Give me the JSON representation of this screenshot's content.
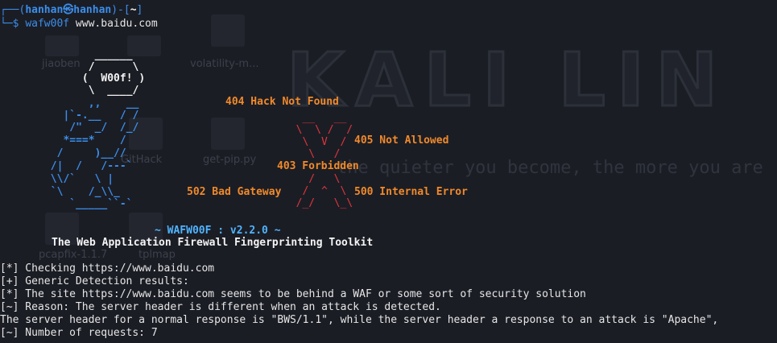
{
  "prompt": {
    "corner": "┌──(",
    "user": "hanhan㉿hanhan",
    "mid": ")-[",
    "dir": "~",
    "end": "]",
    "dollar": "└─$ ",
    "command": "wafw00f",
    "target": " www.baidu.com"
  },
  "background": {
    "motto": "the quieter you become, the more you are",
    "icons": [
      "jiaoben",
      "volatility-m...",
      "get-pip.py",
      "pcapfix-1.1.7",
      "GitHack",
      "tplmap"
    ]
  },
  "banner": {
    "owl": [
      "              ______",
      "             /      \\",
      "            (  W00f! )",
      "             \\  ____/",
      "             ,,    __",
      "         |`-.__   / /",
      "          /\"  _/  /_/",
      "         *===*    /",
      "        /     )__//",
      "       /|  /   /---`",
      "       \\\\/`   \\ |",
      "       `\\    /_\\\\_",
      "          `_____``-`"
    ],
    "x_art": [
      "   __   __",
      "  \\  \\ /  /",
      "   \\  V  /",
      "    \\   /",
      "    /   \\",
      "   /  ^  \\",
      "  /  / \\  \\",
      "  /_/   \\_\\"
    ],
    "codes": {
      "c404": "404 Hack Not Found",
      "c405": "405 Not Allowed",
      "c403": "403 Forbidden",
      "c502": "502 Bad Gateway",
      "c500": "500 Internal Error"
    },
    "version": "~ WAFW00F : v2.2.0 ~",
    "subtitle": "The Web Application Firewall Fingerprinting Toolkit"
  },
  "output": [
    "[*] Checking https://www.baidu.com",
    "[+] Generic Detection results:",
    "[*] The site https://www.baidu.com seems to be behind a WAF or some sort of security solution",
    "[~] Reason: The server header is different when an attack is detected.",
    "The server header for a normal response is \"BWS/1.1\", while the server header a response to an attack is \"Apache\",",
    "[~] Number of requests: 7"
  ],
  "colors": {
    "background": "#1b1d25",
    "prompt_blue": "#3b8eea",
    "owl_blue": "#3b8eea",
    "x_red": "#e0363a",
    "code_orange": "#f08a2a",
    "text": "#e6e6e6"
  }
}
